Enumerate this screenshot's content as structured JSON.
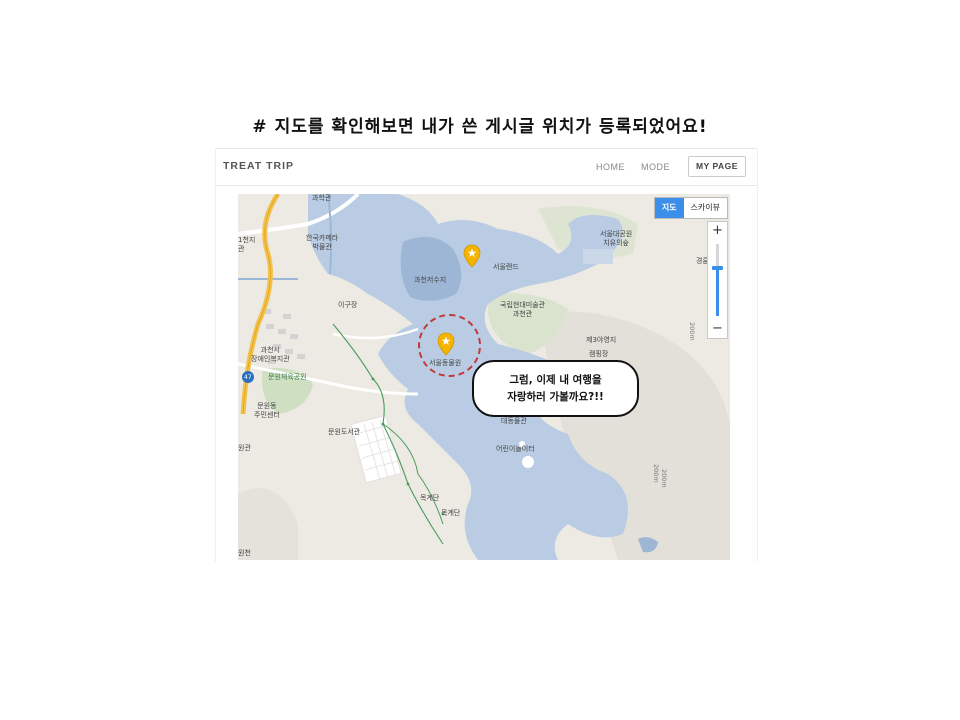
{
  "caption": "# 지도를 확인해보면 내가 쓴 게시글 위치가 등록되었어요!",
  "navbar": {
    "brand": "TREAT TRIP",
    "home": "HOME",
    "mode": "MODE",
    "my_page": "MY PAGE"
  },
  "map": {
    "type_buttons": {
      "map": "지도",
      "skyview": "스카이뷰"
    },
    "active_type": "지도",
    "zoom": {
      "in": "+",
      "out": "−",
      "level_fraction": 0.67
    },
    "labels": {
      "gwacheon_lab": "과학관",
      "museum_line1": "한국카메라",
      "museum_line2": "박물관",
      "left_top1": "1천지",
      "left_top2": "관",
      "reservoir": "과천저수지",
      "seoul_land": "서울랜드",
      "grand_park_line1": "서울대공원",
      "grand_park_line2": "치유의숲",
      "mmca_line1": "국립현대미술관",
      "mmca_line2": "과천관",
      "igu": "이구장",
      "zoo": "서울동물원",
      "jeil_parking": "제3야영지",
      "camping": "캠핑장",
      "welfare_line1": "과천시",
      "welfare_line2": "장애인복지관",
      "route_47": "47",
      "munwon_park": "문원체육공원",
      "munwon_center_line1": "문원동",
      "munwon_center_line2": "주민센터",
      "munwon_library": "문원도서관",
      "daedong": "대동물관",
      "kids_zoo": "어린이놀이터",
      "mokgyedan1": "목계단",
      "mokgyedan2": "목계단",
      "right_edge": "경륜",
      "left_bottom": "원관",
      "left_mid": "원천",
      "alt1": "200m",
      "alt2": "200m",
      "alt3": "200m"
    }
  },
  "bubble": {
    "line1": "그럼, 이제 내 여행을",
    "line2": "자랑하러 가볼까요?!!"
  },
  "colors": {
    "water": "#b9cce3",
    "land": "#eceae3",
    "pin": "#f4b400",
    "highlight": "#c0393b",
    "accent": "#3b8eea"
  }
}
